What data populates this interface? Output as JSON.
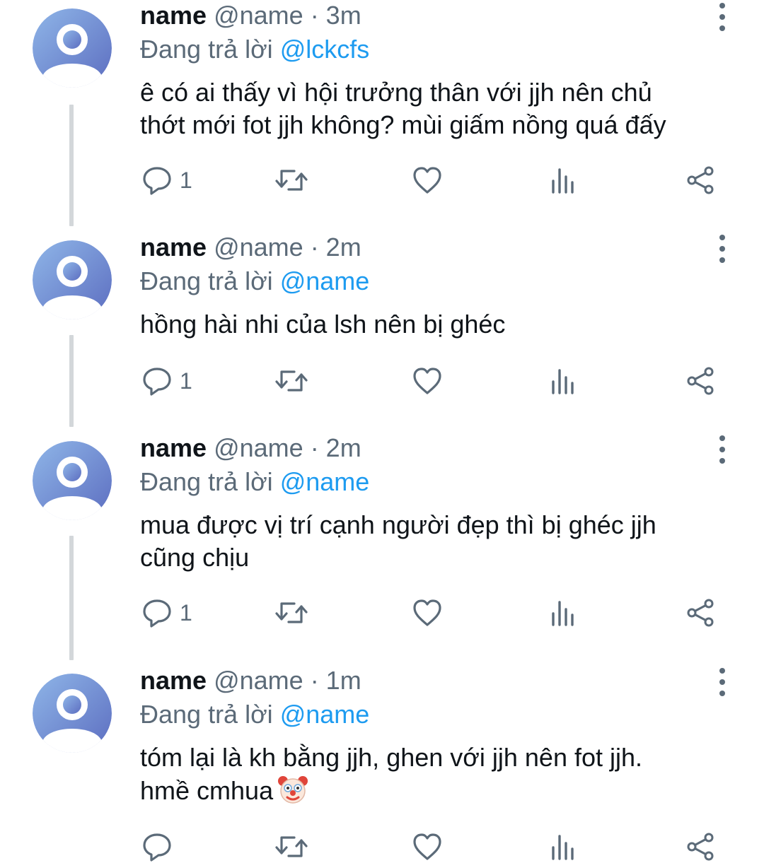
{
  "colors": {
    "name": "#0f1419",
    "meta": "#5b6a78",
    "mention": "#1d9bf0",
    "thread_line": "#d3d7da",
    "avatar_gradient_start": "#8fb6e8",
    "avatar_gradient_end": "#5c6dc0"
  },
  "icons": {
    "reply": "reply-icon",
    "retweet": "retweet-icon",
    "like": "heart-icon",
    "stats": "stats-icon",
    "share": "share-icon",
    "more": "more-vertical-icon",
    "emoji": "clown-face-emoji"
  },
  "tweets": [
    {
      "name": "name",
      "handle": "@name",
      "time": "· 3m",
      "replying_prefix": "Đang trả lời",
      "replying_to": "@lckcfs",
      "text_lines": [
        "ê có ai thấy vì hội trưởng thân với jjh nên chủ",
        "thớt mới fot jjh không? mùi giấm nồng quá đấy"
      ],
      "reply_count": "1"
    },
    {
      "name": "name",
      "handle": "@name",
      "time": "· 2m",
      "replying_prefix": "Đang trả lời",
      "replying_to": "@name",
      "text_lines": [
        "hồng hài nhi của lsh nên bị ghéc"
      ],
      "reply_count": "1"
    },
    {
      "name": "name",
      "handle": "@name",
      "time": "· 2m",
      "replying_prefix": "Đang trả lời",
      "replying_to": "@name",
      "text_lines": [
        "mua được vị trí cạnh người đẹp thì bị ghéc jjh",
        "cũng chịu"
      ],
      "reply_count": "1"
    },
    {
      "name": "name",
      "handle": "@name",
      "time": "· 1m",
      "replying_prefix": "Đang trả lời",
      "replying_to": "@name",
      "text_lines": [
        "tóm lại là kh bằng jjh, ghen với jjh nên fot jjh.",
        "hmề cmhua"
      ],
      "reply_count": ""
    }
  ]
}
